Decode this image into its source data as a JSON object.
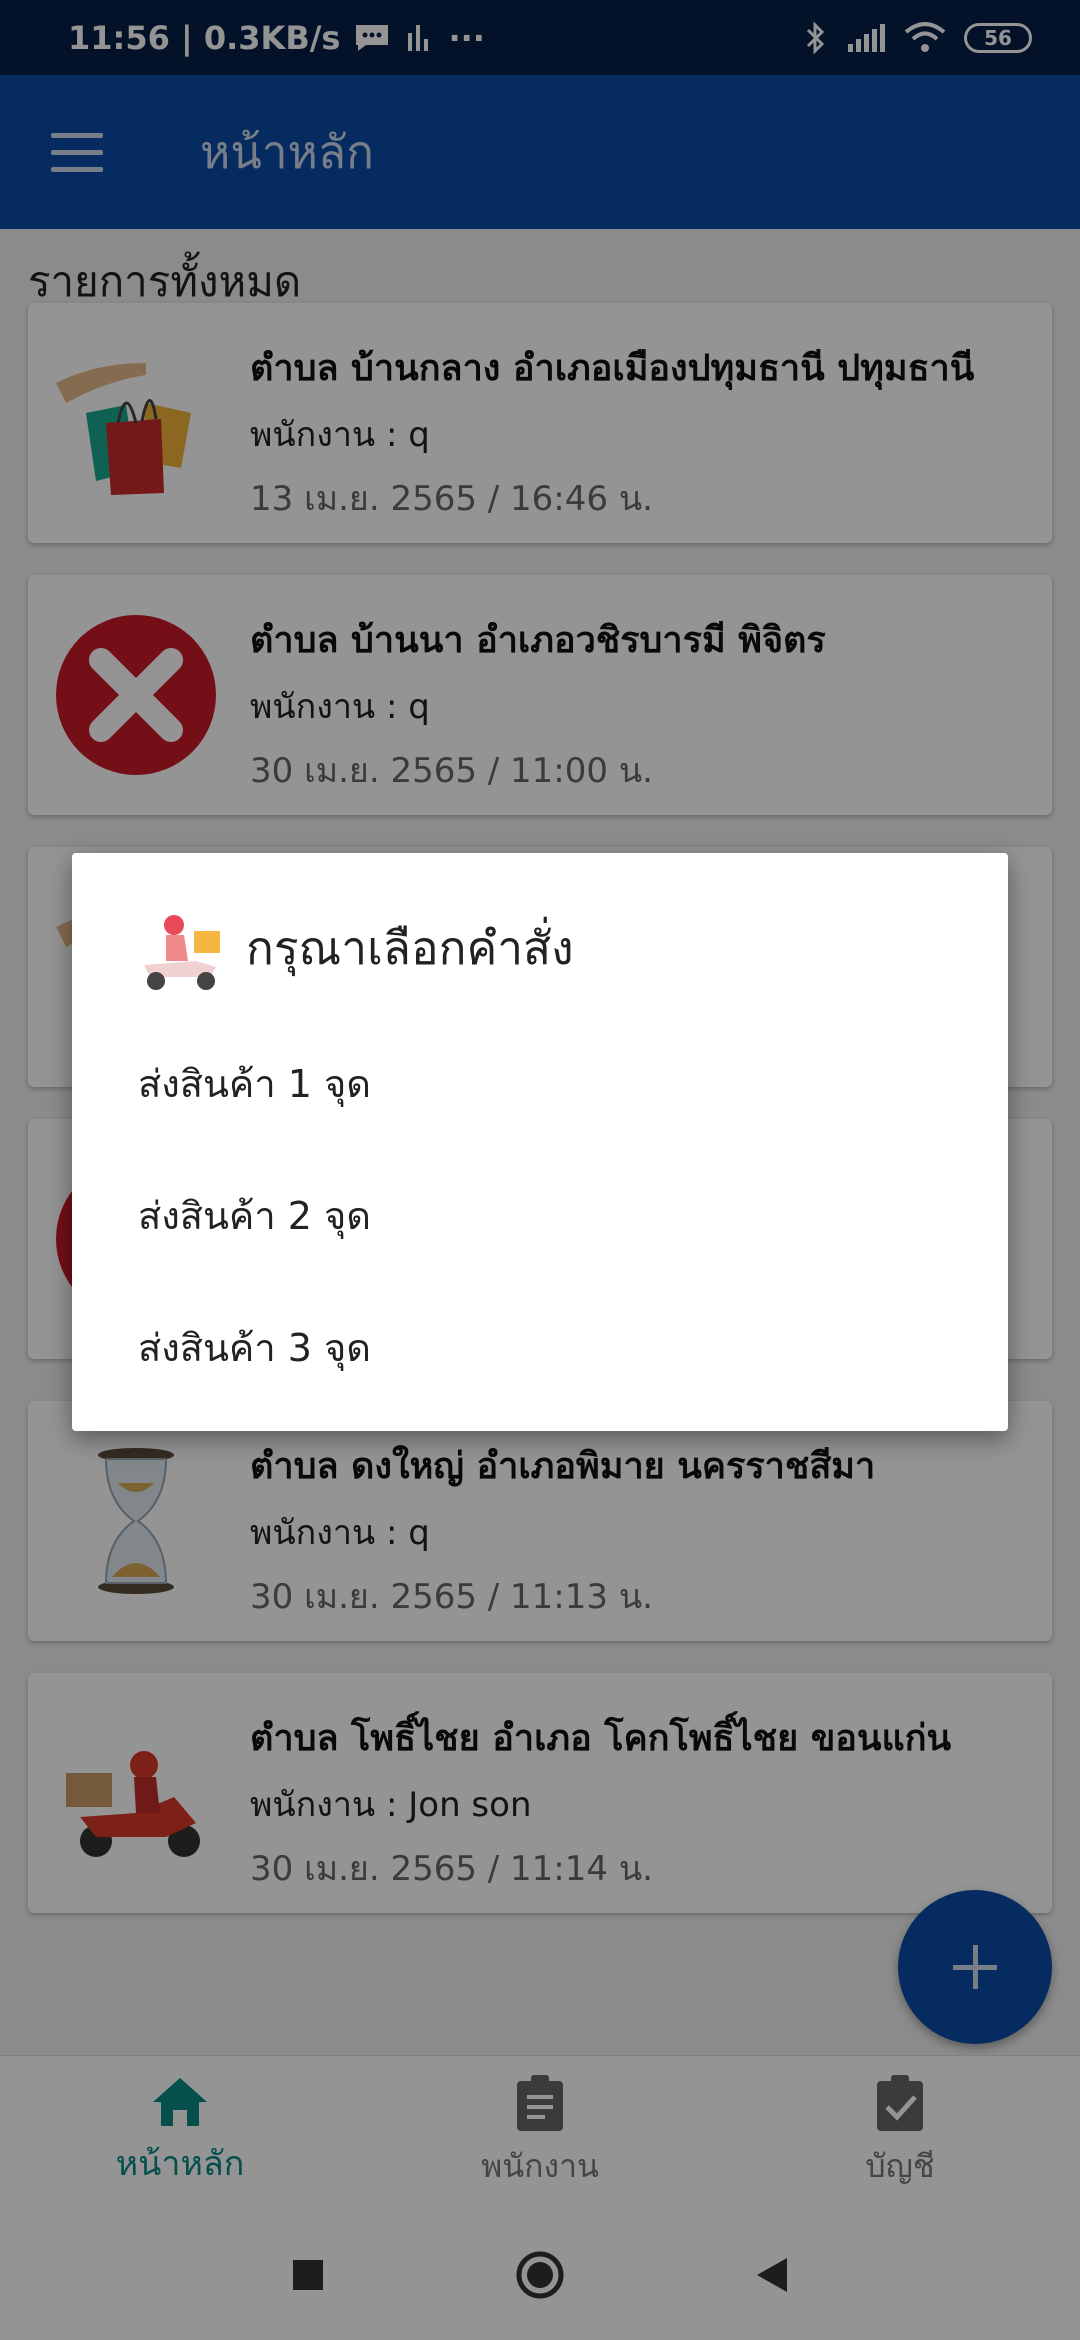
{
  "status_bar": {
    "time_speed": "11:56 | 0.3KB/s",
    "more": "···",
    "battery": "56"
  },
  "app_bar": {
    "title": "หน้าหลัก"
  },
  "section_title": "รายการทั้งหมด",
  "cards": [
    {
      "title": "ตำบล บ้านกลาง อำเภอเมืองปทุมธานี ปทุมธานี",
      "staff": "พนักงาน : q",
      "date": "13 เม.ย. 2565 / 16:46 น.",
      "icon": "shopping-bags-icon"
    },
    {
      "title": "ตำบล บ้านนา อำเภอวชิรบารมี พิจิตร",
      "staff": "พนักงาน : q",
      "date": "30 เม.ย. 2565 / 11:00 น.",
      "icon": "cancel-x-icon"
    },
    {
      "title": "",
      "staff": "",
      "date": "",
      "icon": "shopping-bags-icon"
    },
    {
      "title": "",
      "staff": "",
      "date": "",
      "icon": "cancel-x-icon"
    },
    {
      "title": "ตำบล ดงใหญ่ อำเภอพิมาย นครราชสีมา",
      "staff": "พนักงาน : q",
      "date": "30 เม.ย. 2565 / 11:13 น.",
      "icon": "hourglass-icon"
    },
    {
      "title": "ตำบล โพธิ์ไชย อำเภอ โคกโพธิ์ไชย ขอนแก่น",
      "staff": "พนักงาน : Jon son",
      "date": "30 เม.ย. 2565 / 11:14 น.",
      "icon": "delivery-scooter-icon"
    }
  ],
  "bottom_nav": [
    {
      "label": "หน้าหลัก",
      "icon": "home-icon",
      "active": true
    },
    {
      "label": "พนักงาน",
      "icon": "clipboard-icon",
      "active": false
    },
    {
      "label": "บัญชี",
      "icon": "clipboard-check-icon",
      "active": false
    }
  ],
  "dialog": {
    "title": "กรุณาเลือกคำสั่ง",
    "options": [
      "ส่งสินค้า 1 จุด",
      "ส่งสินค้า 2 จุด",
      "ส่งสินค้า 3 จุด"
    ]
  },
  "colors": {
    "status_bar": "#061f46",
    "app_bar": "#0a4aa6",
    "accent": "#0a8a85"
  }
}
